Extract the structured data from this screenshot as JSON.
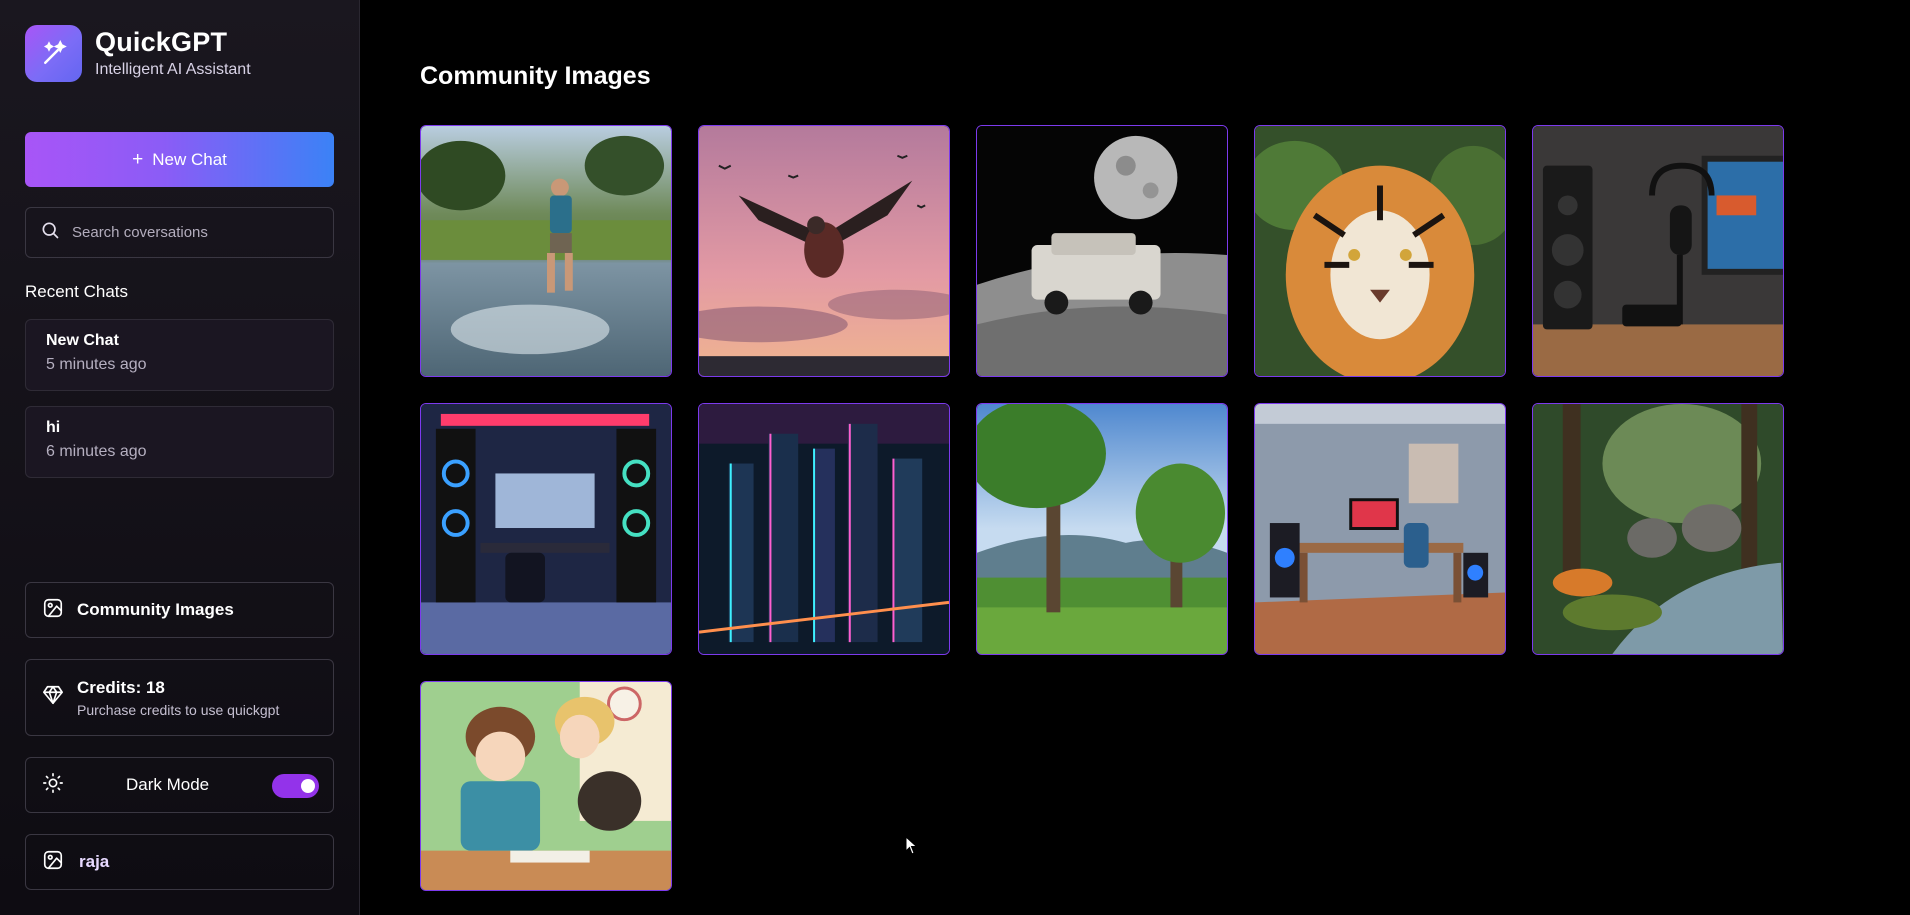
{
  "brand": {
    "name": "QuickGPT",
    "tagline": "Intelligent AI Assistant",
    "logo_icon": "magic-wand-icon"
  },
  "sidebar": {
    "new_chat_label": "New Chat",
    "search_placeholder": "Search coversations",
    "recent_title": "Recent Chats",
    "recent_chats": [
      {
        "title": "New Chat",
        "time": "5 minutes ago"
      },
      {
        "title": "hi",
        "time": "6 minutes ago"
      }
    ],
    "community_label": "Community Images",
    "credits_label": "Credits: 18",
    "credits_sub": "Purchase credits to use quickgpt",
    "dark_mode_label": "Dark Mode",
    "dark_mode_on": true,
    "user_name": "raja"
  },
  "main": {
    "title": "Community Images",
    "images": [
      "boy-running-in-lake",
      "eagle-pink-sunset",
      "car-on-moon",
      "tiger-portrait",
      "podcast-desk-setup",
      "rgb-gaming-room",
      "neon-cyberpunk-city",
      "green-park-trees",
      "home-office-room",
      "jungle-tiger-elephants",
      "anime-classroom"
    ]
  },
  "colors": {
    "accent": "#a855f7",
    "gradient_end": "#3b82f6",
    "border": "#7c3aed"
  }
}
